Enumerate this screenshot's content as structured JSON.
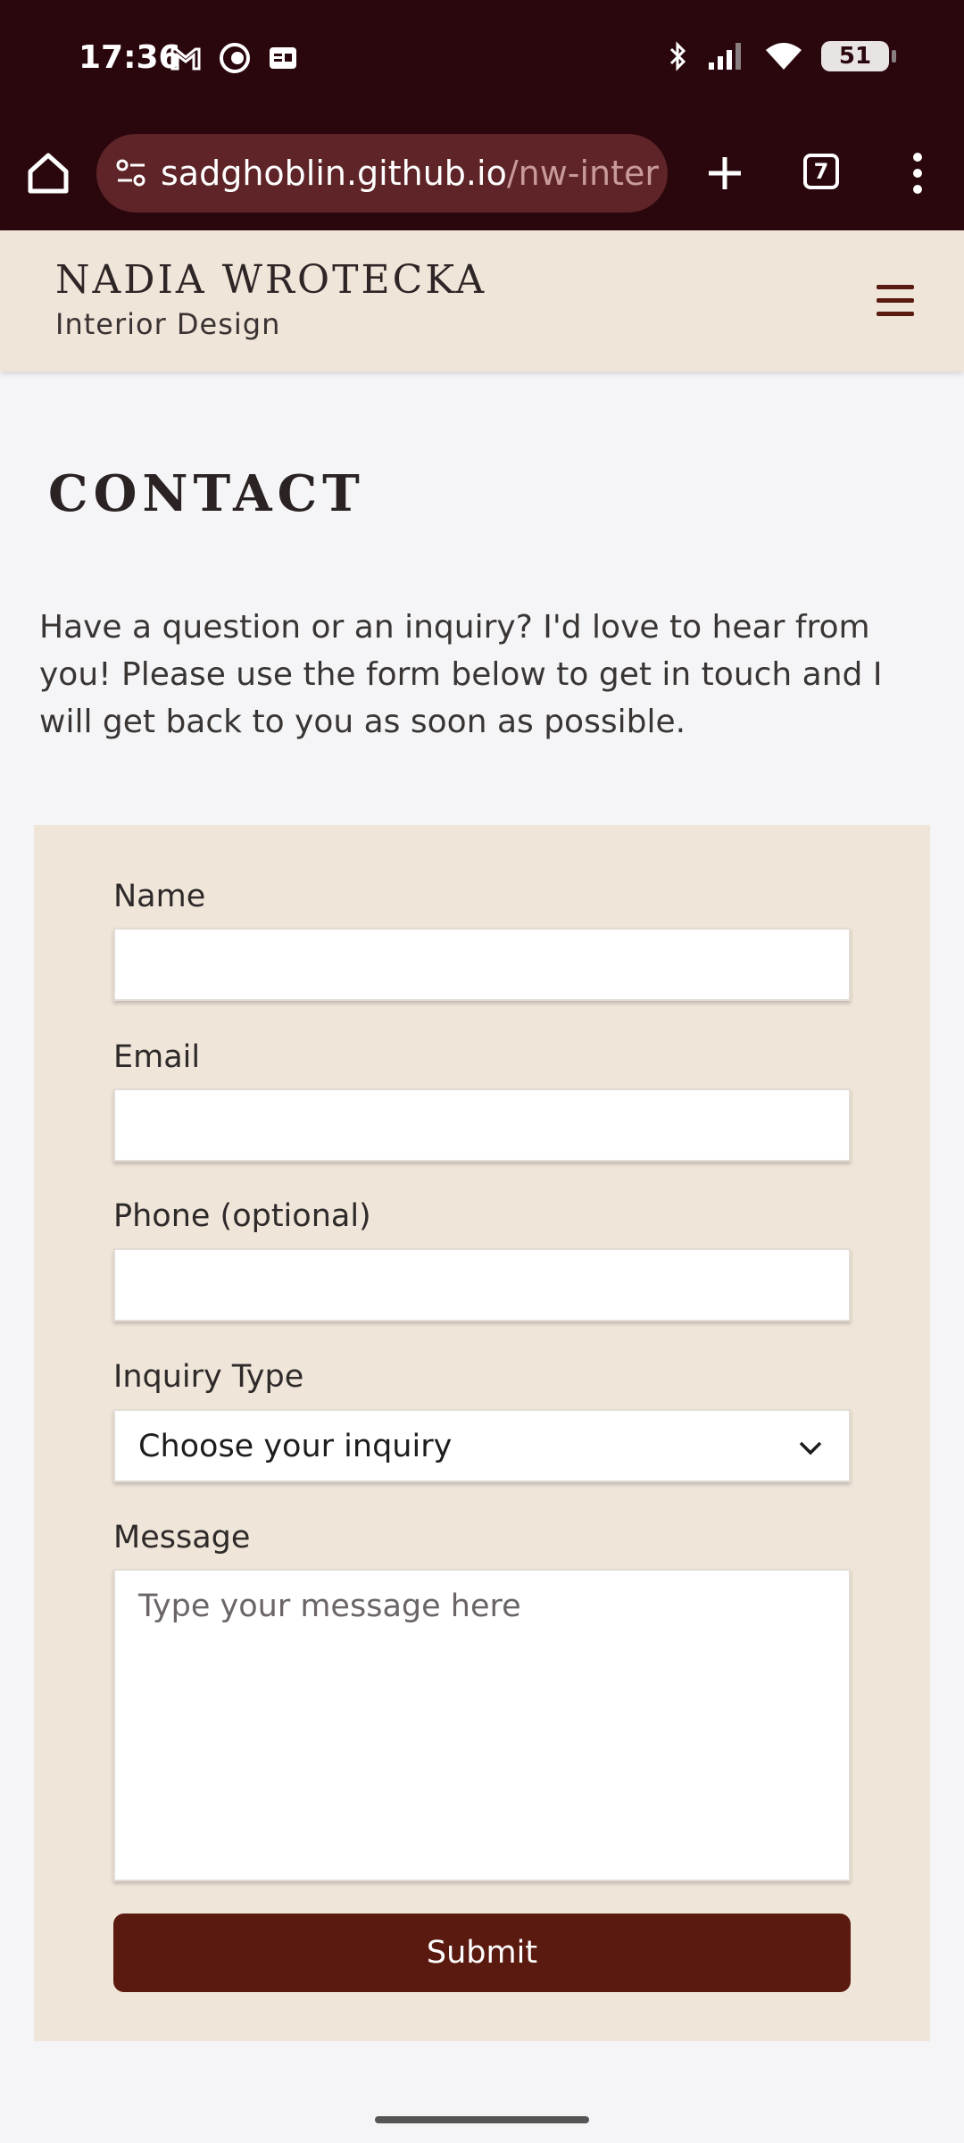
{
  "status_bar": {
    "time": "17:36",
    "battery_level": "51",
    "icons": [
      "gmail-icon",
      "app-icon",
      "news-icon",
      "bluetooth-icon",
      "signal-icon",
      "wifi-icon",
      "battery-icon"
    ]
  },
  "browser": {
    "url_host": "sadghoblin.github.io",
    "url_path": "/nw-interio",
    "tab_count": "7"
  },
  "site": {
    "brand_name": "NADIA WROTECKA",
    "brand_sub": "Interior Design"
  },
  "page": {
    "title": "CONTACT",
    "intro": "Have a question or an inquiry? I'd love to hear from you! Please use the form below to get in touch and I will get back to you as soon as possible."
  },
  "form": {
    "name_label": "Name",
    "name_value": "",
    "email_label": "Email",
    "email_value": "",
    "phone_label": "Phone (optional)",
    "phone_value": "",
    "inquiry_label": "Inquiry Type",
    "inquiry_selected": "Choose your inquiry",
    "message_label": "Message",
    "message_placeholder": "Type your message here",
    "submit_label": "Submit"
  },
  "colors": {
    "chrome_bg": "#2a070d",
    "omnibox_bg": "#5e2427",
    "header_bg": "#efe5d9",
    "button_bg": "#5a1a0f"
  }
}
